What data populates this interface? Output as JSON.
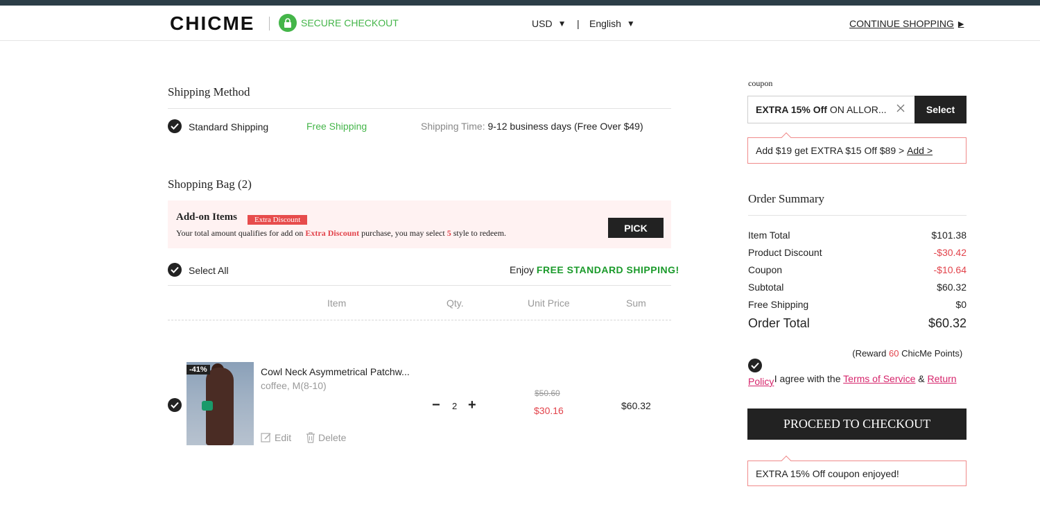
{
  "header": {
    "logo": "CHICME",
    "secure_label": "SECURE CHECKOUT",
    "currency": "USD",
    "separator": "|",
    "language": "English",
    "continue_label": "CONTINUE SHOPPING"
  },
  "shipping": {
    "title": "Shipping Method",
    "method": "Standard Shipping",
    "cost": "Free Shipping",
    "time_label": "Shipping Time:",
    "time_value": "9-12 business days (Free Over $49)"
  },
  "bag": {
    "title": "Shopping Bag (2)",
    "addon_title": "Add-on Items",
    "addon_badge": "Extra Discount",
    "addon_text_1": "Your total amount qualifies for add on ",
    "addon_text_highlight": "Extra Discount",
    "addon_text_2": " purchase, you may select ",
    "addon_count": "5",
    "addon_text_3": " style to redeem.",
    "pick_label": "PICK",
    "select_all": "Select All",
    "enjoy_prefix": "Enjoy ",
    "enjoy_highlight": "FREE STANDARD SHIPPING!",
    "columns": [
      "Item",
      "Qty.",
      "Unit Price",
      "Sum"
    ],
    "items": [
      {
        "discount_tag": "-41%",
        "name": "Cowl Neck Asymmetrical Patchw...",
        "variant": "coffee, M(8-10)",
        "qty": "2",
        "original_price": "$50.60",
        "price": "$30.16",
        "sum": "$60.32",
        "edit_label": "Edit",
        "delete_label": "Delete"
      }
    ]
  },
  "coupon": {
    "label": "coupon",
    "value_bold": "EXTRA 15% Off",
    "value_rest": " ON ALLOR...",
    "select_label": "Select",
    "add_prompt": "Add $19 get EXTRA $15 Off $89 > ",
    "add_link": "Add >"
  },
  "summary": {
    "title": "Order Summary",
    "rows": [
      {
        "label": "Item Total",
        "value": "$101.38"
      },
      {
        "label": "Product Discount",
        "value": "-$30.42"
      },
      {
        "label": "Coupon",
        "value": "-$10.64"
      },
      {
        "label": "Subtotal",
        "value": "$60.32"
      },
      {
        "label": "Free Shipping",
        "value": "$0"
      }
    ],
    "total_label": "Order Total",
    "total_value": "$60.32",
    "reward_prefix": "(Reward ",
    "reward_points": "60",
    "reward_suffix": " ChicMe Points)",
    "agree_prefix": "I agree with the ",
    "terms_link": "Terms of Service",
    "agree_and": " & ",
    "return_link": "Return",
    "policy_link": "Policy",
    "checkout_label": "PROCEED TO CHECKOUT",
    "coupon_enjoyed": "EXTRA 15% Off coupon enjoyed!"
  },
  "colors": {
    "accent_green": "#44b549",
    "accent_red": "#e2434b",
    "accent_pink": "#d6246b",
    "dark": "#222222"
  }
}
